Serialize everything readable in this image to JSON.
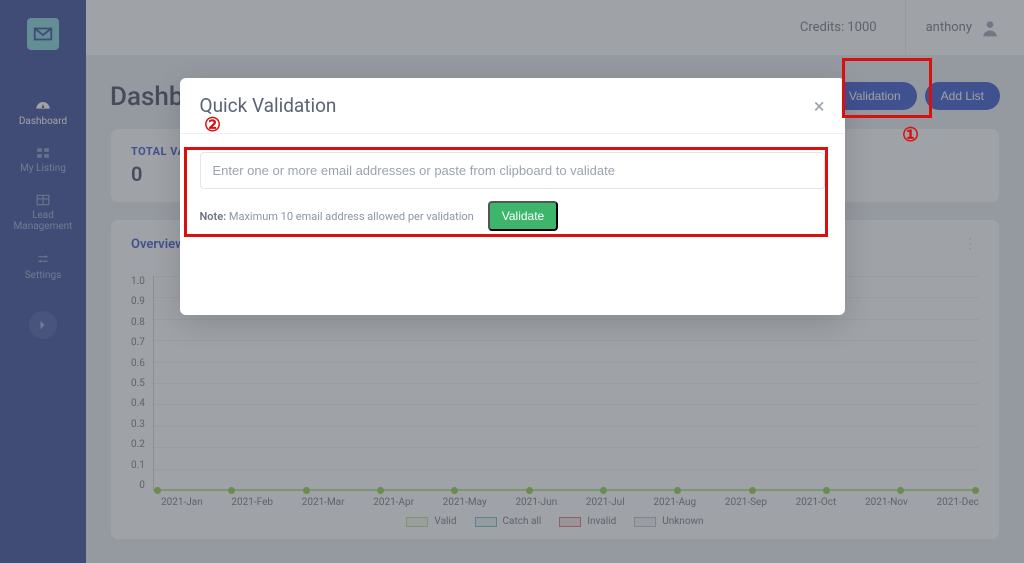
{
  "sidebar": {
    "items": [
      {
        "label": "Dashboard"
      },
      {
        "label": "My Listing"
      },
      {
        "label": "Lead Management"
      },
      {
        "label": "Settings"
      }
    ]
  },
  "topbar": {
    "credits_label": "Credits: 1000",
    "username": "anthony"
  },
  "page": {
    "title": "Dashboard",
    "quick_validation_btn": "Quick Validation",
    "add_list_btn": "Add List"
  },
  "stat": {
    "label": "TOTAL VALIDATIONS",
    "value": "0"
  },
  "chart": {
    "title": "Overview"
  },
  "chart_data": {
    "type": "line",
    "title": "Overview",
    "xlabel": "",
    "ylabel": "",
    "ylim": [
      0,
      1.0
    ],
    "y_ticks": [
      "1.0",
      "0.9",
      "0.8",
      "0.7",
      "0.6",
      "0.5",
      "0.4",
      "0.3",
      "0.2",
      "0.1",
      "0"
    ],
    "categories": [
      "2021-Jan",
      "2021-Feb",
      "2021-Mar",
      "2021-Apr",
      "2021-May",
      "2021-Jun",
      "2021-Jul",
      "2021-Aug",
      "2021-Sep",
      "2021-Oct",
      "2021-Nov",
      "2021-Dec"
    ],
    "series": [
      {
        "name": "Valid",
        "color": "#b6e08a",
        "values": [
          0,
          0,
          0,
          0,
          0,
          0,
          0,
          0,
          0,
          0,
          0,
          0
        ]
      },
      {
        "name": "Catch all",
        "color": "#6fb9be",
        "values": [
          0,
          0,
          0,
          0,
          0,
          0,
          0,
          0,
          0,
          0,
          0,
          0
        ]
      },
      {
        "name": "Invalid",
        "color": "#e06b6b",
        "values": [
          0,
          0,
          0,
          0,
          0,
          0,
          0,
          0,
          0,
          0,
          0,
          0
        ]
      },
      {
        "name": "Unknown",
        "color": "#b8bfc6",
        "values": [
          0,
          0,
          0,
          0,
          0,
          0,
          0,
          0,
          0,
          0,
          0,
          0
        ]
      }
    ]
  },
  "modal": {
    "title": "Quick Validation",
    "placeholder": "Enter one or more email addresses or paste from clipboard to validate",
    "note_label": "Note:",
    "note_text": "Maximum 10 email address allowed per validation",
    "validate_btn": "Validate"
  },
  "annotations": {
    "one": "①",
    "two": "②"
  }
}
